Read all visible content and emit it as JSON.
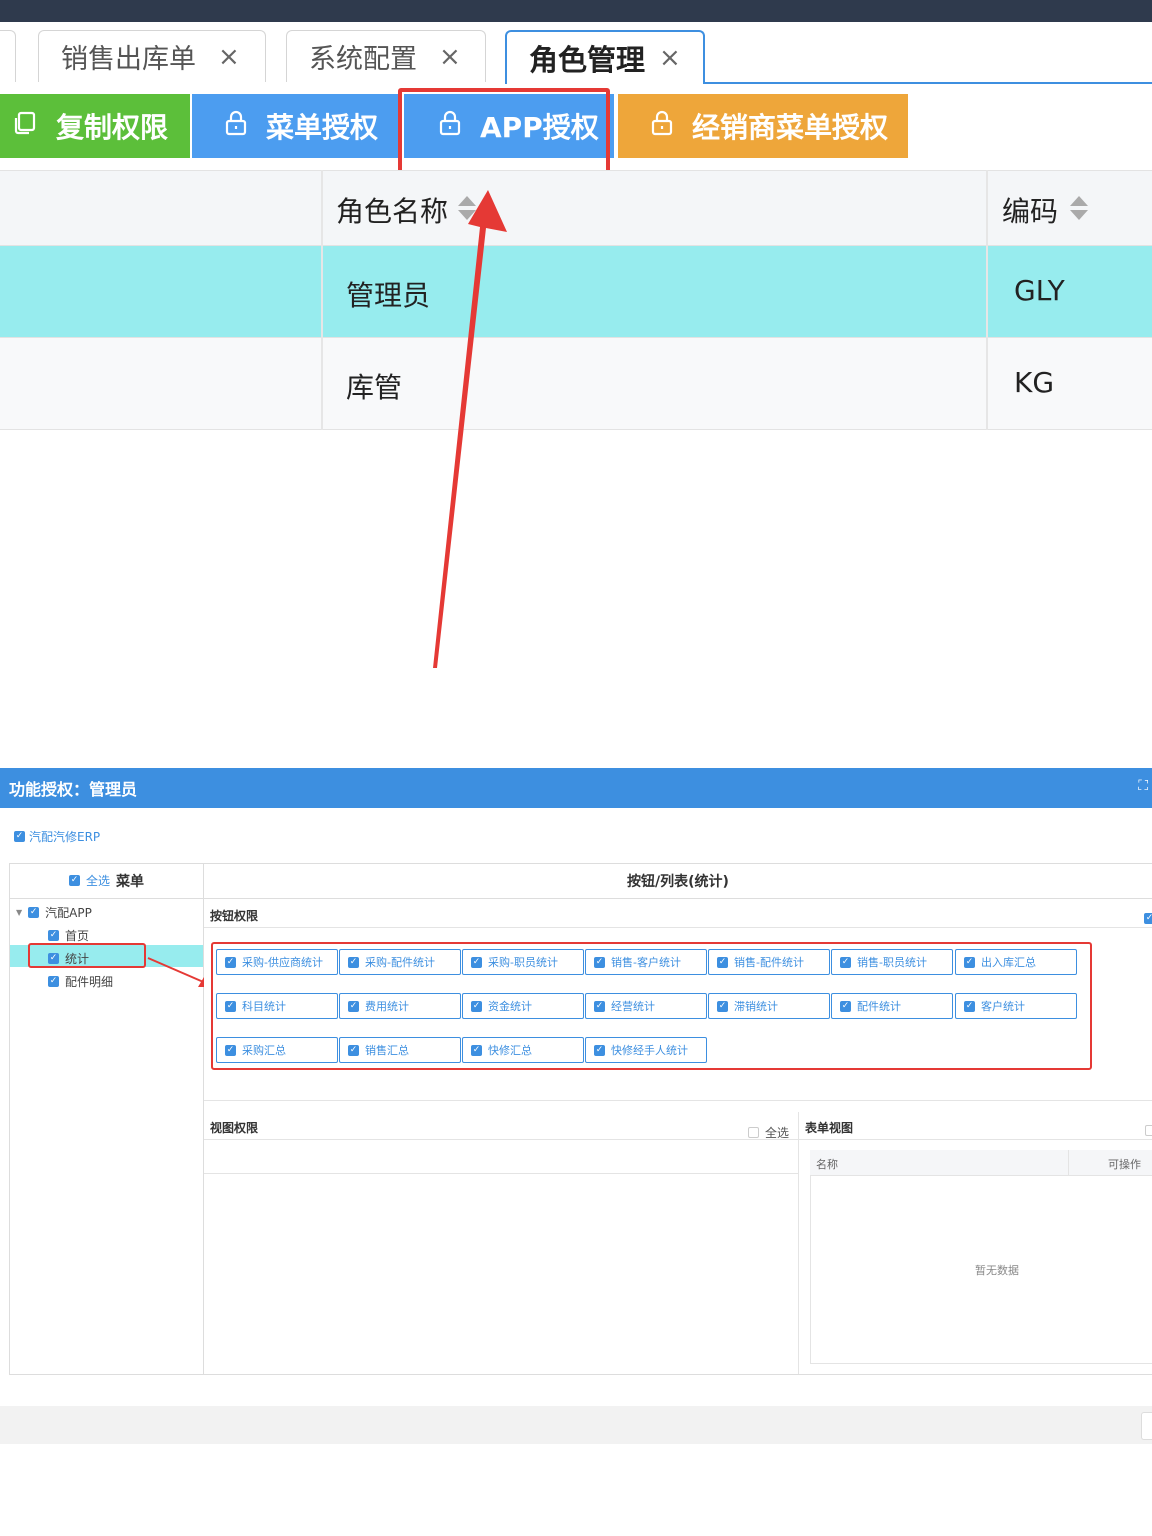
{
  "tabs": [
    {
      "label": "销售出库单",
      "close": "×"
    },
    {
      "label": "系统配置",
      "close": "×"
    },
    {
      "label": "角色管理",
      "close": "×",
      "active": true
    }
  ],
  "toolbar": {
    "copy": {
      "icon": "copy-icon",
      "label": "复制权限"
    },
    "menu_auth": {
      "icon": "lock-icon",
      "label": "菜单授权"
    },
    "app_auth": {
      "icon": "lock-icon",
      "label": "APP授权"
    },
    "dealer_auth": {
      "icon": "lock-icon",
      "label": "经销商菜单授权"
    }
  },
  "grid": {
    "headers": {
      "role_name": "角色名称",
      "code": "编码"
    },
    "rows": [
      {
        "role_name": "管理员",
        "code": "GLY",
        "selected": true
      },
      {
        "role_name": "库管",
        "code": "KG",
        "selected": false
      }
    ]
  },
  "dialog": {
    "title": "功能授权：管理员",
    "erp_label": "汽配汽修ERP",
    "menu_panel": {
      "select_all": "全选",
      "title": "菜单"
    },
    "tree": [
      {
        "label": "汽配APP",
        "level": 0
      },
      {
        "label": "首页",
        "level": 1
      },
      {
        "label": "统计",
        "level": 1,
        "selected": true
      },
      {
        "label": "配件明细",
        "level": 1
      }
    ],
    "right_title": "按钮/列表(统计)",
    "button_perm_label": "按钮权限",
    "buttons": [
      "采购-供应商统计",
      "采购-配件统计",
      "采购-职员统计",
      "销售-客户统计",
      "销售-配件统计",
      "销售-职员统计",
      "出入库汇总",
      "科目统计",
      "费用统计",
      "资金统计",
      "经营统计",
      "滞销统计",
      "配件统计",
      "客户统计",
      "采购汇总",
      "销售汇总",
      "快修汇总",
      "快修经手人统计"
    ],
    "view_perm_label": "视图权限",
    "view_select_all": "全选",
    "form_view_label": "表单视图",
    "form_table_headers": {
      "name": "名称",
      "operable": "可操作"
    },
    "empty_text": "暂无数据"
  },
  "colors": {
    "accent": "#3d8fe0",
    "green": "#5cbf3a",
    "orange": "#eea63a",
    "highlight": "#97ecee",
    "annotation_red": "#e53935"
  }
}
